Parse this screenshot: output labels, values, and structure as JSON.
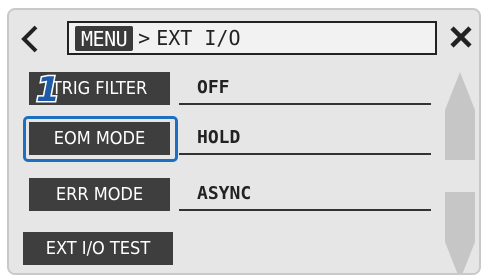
{
  "header": {
    "menu_label": "MENU",
    "separator": ">",
    "path": "EXT I/O"
  },
  "rows": [
    {
      "label": "TRIG FILTER",
      "value": "OFF"
    },
    {
      "label": "EOM MODE",
      "value": "HOLD"
    },
    {
      "label": "ERR MODE",
      "value": "ASYNC"
    },
    {
      "label": "EXT I/O TEST",
      "value": ""
    }
  ],
  "callout": {
    "number": "1"
  },
  "colors": {
    "accent": "#1e6fbf",
    "button_bg": "#3e3e3e",
    "screen_bg": "#e6e6e6"
  }
}
